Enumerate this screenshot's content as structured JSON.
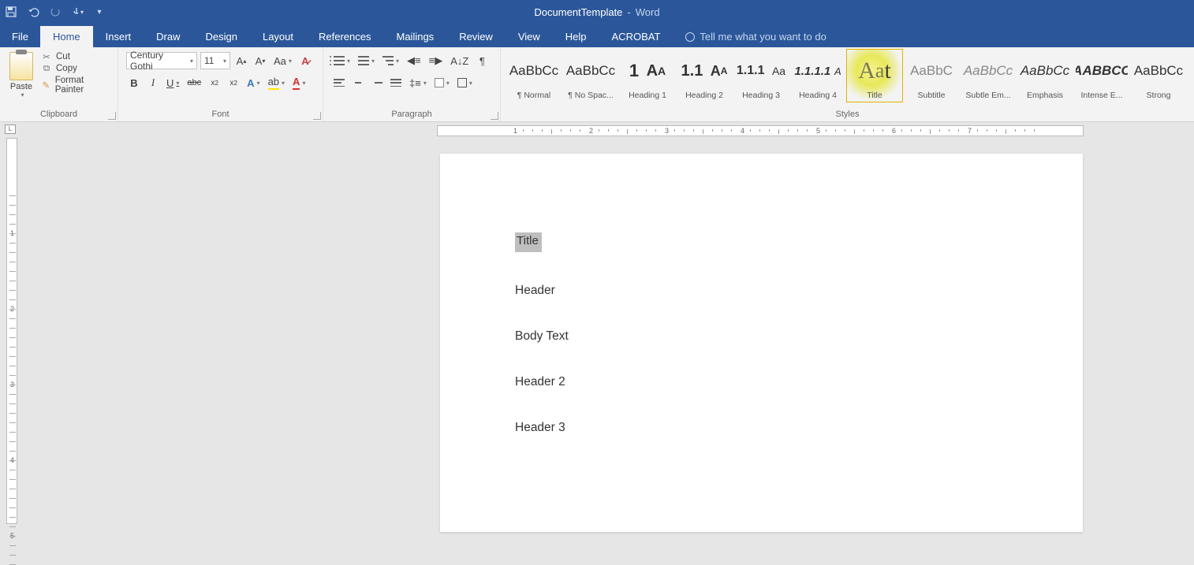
{
  "titlebar": {
    "document": "DocumentTemplate",
    "sep": "-",
    "app": "Word"
  },
  "tabs": [
    "File",
    "Home",
    "Insert",
    "Draw",
    "Design",
    "Layout",
    "References",
    "Mailings",
    "Review",
    "View",
    "Help",
    "ACROBAT"
  ],
  "active_tab": "Home",
  "tell_me": "Tell me what you want to do",
  "clipboard": {
    "paste": "Paste",
    "cut": "Cut",
    "copy": "Copy",
    "format_painter": "Format Painter",
    "label": "Clipboard"
  },
  "font": {
    "name": "Century Gothi",
    "size": "11",
    "label": "Font"
  },
  "paragraph": {
    "label": "Paragraph"
  },
  "styles": {
    "label": "Styles",
    "items": [
      {
        "preview": "AaBbCc",
        "name": "¶ Normal",
        "cls": ""
      },
      {
        "preview": "AaBbCc",
        "name": "¶ No Spac...",
        "cls": ""
      },
      {
        "preview": "1  Aᴀ",
        "name": "Heading 1",
        "cls": "h1"
      },
      {
        "preview": "1.1  Aᴀ",
        "name": "Heading 2",
        "cls": "h2"
      },
      {
        "preview": "1.1.1  Aa",
        "name": "Heading 3",
        "cls": "h3"
      },
      {
        "preview": "1.1.1.1  A",
        "name": "Heading 4",
        "cls": "h4"
      },
      {
        "preview": "Aat",
        "name": "Title",
        "cls": "title",
        "selected": true
      },
      {
        "preview": "AaBbC",
        "name": "Subtitle",
        "cls": "sub"
      },
      {
        "preview": "AaBbCc",
        "name": "Subtle Em...",
        "cls": "se"
      },
      {
        "preview": "AaBbCc",
        "name": "Emphasis",
        "cls": "em"
      },
      {
        "preview": "AABBCC",
        "name": "Intense E...",
        "cls": "ie"
      },
      {
        "preview": "AaBbCc",
        "name": "Strong",
        "cls": "str"
      }
    ]
  },
  "document": {
    "title": "Title",
    "lines": [
      "Header",
      "Body Text",
      "Header 2",
      "Header 3"
    ]
  },
  "ruler_numbers": [
    "1",
    "2",
    "3",
    "4",
    "5",
    "6",
    "7"
  ]
}
